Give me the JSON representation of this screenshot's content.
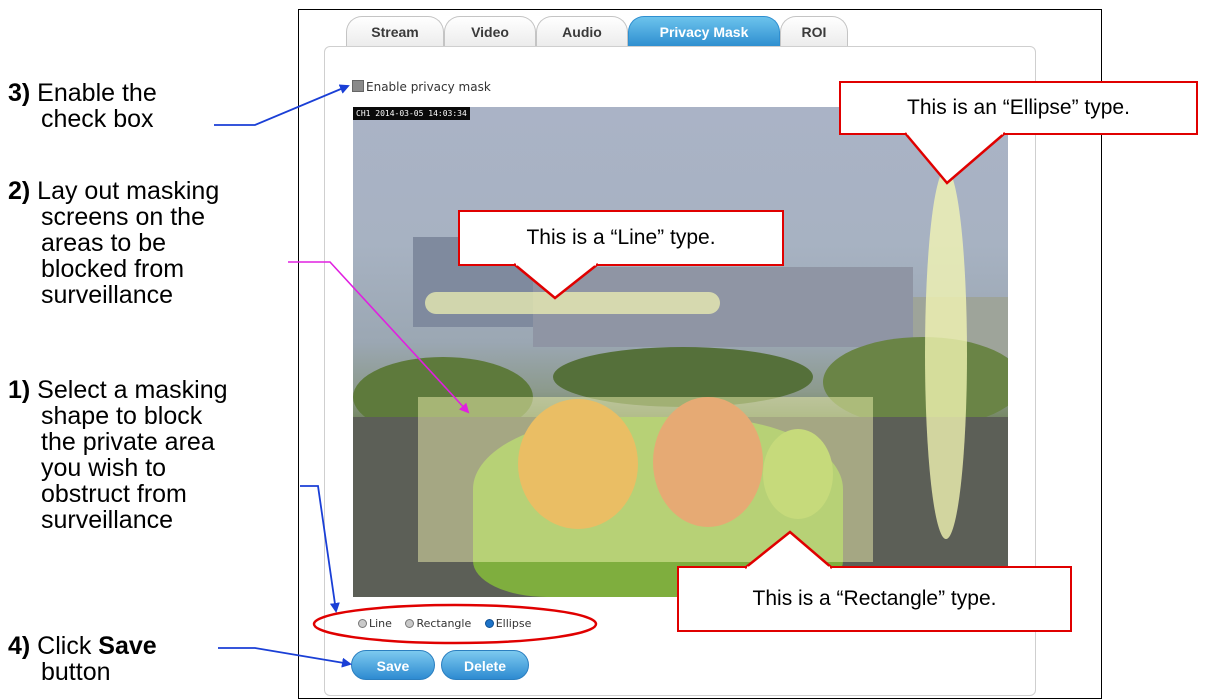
{
  "instructions": {
    "step3": {
      "num": "3)",
      "text_line1": " Enable the",
      "text_line2": "check box"
    },
    "step2": {
      "num": "2)",
      "text_line1": " Lay out masking",
      "lines": [
        "screens on the",
        "areas to be",
        "blocked from",
        "surveillance"
      ]
    },
    "step1": {
      "num": "1)",
      "text_line1": " Select a masking",
      "lines": [
        "shape to block",
        "the private area",
        "you wish to",
        "obstruct from",
        "surveillance"
      ]
    },
    "step4": {
      "num": "4)",
      "text_pre": " Click ",
      "text_bold": "Save",
      "text_line2": "button"
    }
  },
  "tabs": [
    {
      "label": "Stream",
      "active": false
    },
    {
      "label": "Video",
      "active": false
    },
    {
      "label": "Audio",
      "active": false
    },
    {
      "label": "Privacy Mask",
      "active": true
    },
    {
      "label": "ROI",
      "active": false
    }
  ],
  "privacy": {
    "checkbox_label": "Enable privacy mask",
    "checkbox_checked": false,
    "osd_text": "CH1 2014-03-05 14:03:34"
  },
  "callouts": {
    "ellipse": "This is an “Ellipse” type.",
    "line": "This is a “Line” type.",
    "rectangle": "This is a “Rectangle” type."
  },
  "shape_options": {
    "line": "Line",
    "rectangle": "Rectangle",
    "ellipse": "Ellipse",
    "selected": "Ellipse"
  },
  "buttons": {
    "save": "Save",
    "delete": "Delete"
  },
  "colors": {
    "annotation_red": "#e00000",
    "arrow_blue": "#1a3fd6",
    "arrow_magenta": "#e020e0",
    "tab_active": "#2f8fd0",
    "mask_fill": "#f4f6b4"
  }
}
